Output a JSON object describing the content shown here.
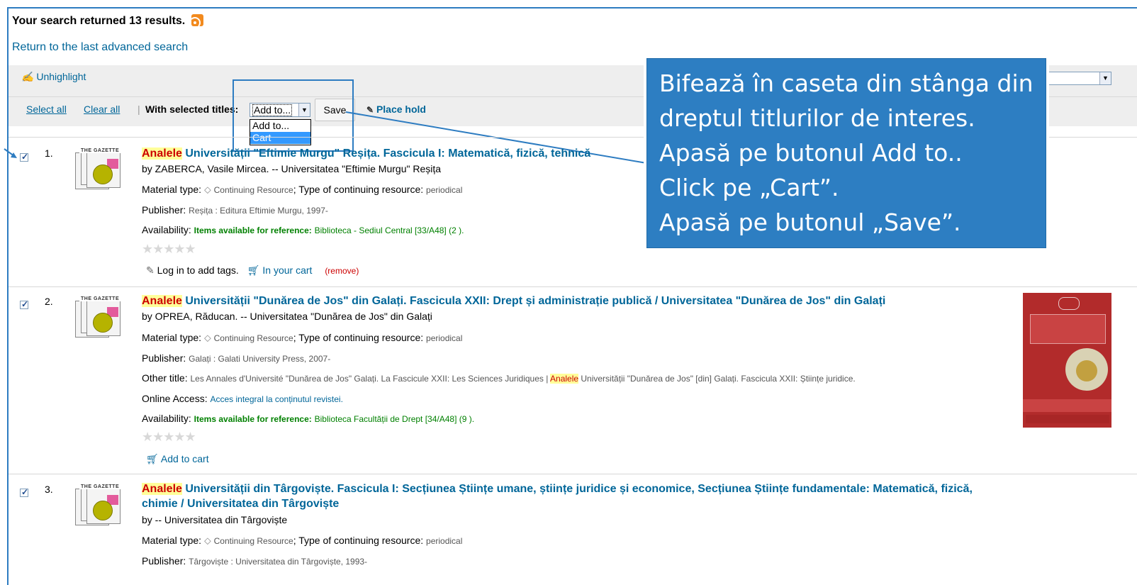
{
  "header": {
    "results_text": "Your search returned 13 results.",
    "return_link": "Return to the last advanced search"
  },
  "toolbar": {
    "unhighlight": "Unhighlight",
    "select_all": "Select all",
    "clear_all": "Clear all",
    "with_selected": "With selected titles:",
    "add_to_value": "Add to...",
    "dropdown_options": [
      "Add to...",
      "Cart"
    ],
    "save_label": "Save",
    "place_hold": "Place hold"
  },
  "callout": {
    "lines": [
      "Bifează în caseta din stânga din",
      "dreptul titlurilor de interes.",
      "Apasă pe butonul Add to..",
      "Click pe „Cart”.",
      "Apasă pe butonul „Save”."
    ]
  },
  "labels": {
    "material_type": "Material type:",
    "continuing_resource": "Continuing Resource",
    "type_of_cr": "; Type of continuing resource:",
    "periodical": "periodical",
    "publisher": "Publisher:",
    "availability": "Availability:",
    "items_available": "Items available for reference:",
    "other_title": "Other title:",
    "online_access": "Online Access:",
    "gazette": "THE GAZETTE"
  },
  "results": [
    {
      "num": "1.",
      "hl": "Analele",
      "title": " Universității \"Eftimie Murgu\" Reșița. Fascicula I: Matematică, fizică, tehnică",
      "by": "by ZABERCA, Vasile Mircea. -- Universitatea \"Eftimie Murgu\" Reșița",
      "publisher": "Reșița : Editura Eftimie Murgu, 1997-",
      "availability": "Biblioteca - Sediul Central [33/A48] (2 ).",
      "tags": "Log in to add tags.",
      "in_cart": "In your cart",
      "remove": "(remove)"
    },
    {
      "num": "2.",
      "hl": "Analele",
      "title": " Universității \"Dunărea de Jos\" din Galați. Fascicula XXII: Drept și administrație publică / Universitatea \"Dunărea de Jos\" din Galați",
      "by": "by OPREA, Răducan. -- Universitatea \"Dunărea de Jos\" din Galați",
      "publisher": "Galați : Galati University Press, 2007-",
      "other_title_pre": "Les Annales d'Université \"Dunărea de Jos\" Galați. La Fascicule XXII: Les Sciences Juridiques | ",
      "other_title_hl": "Analele",
      "other_title_post": " Universității \"Dunărea de Jos\" [din] Galați. Fascicula XXII: Științe juridice.",
      "online_access": "Acces integral la conținutul revistei.",
      "availability": "Biblioteca Facultății de Drept [34/A48] (9 ).",
      "add_to_cart": "Add to cart"
    },
    {
      "num": "3.",
      "hl": "Analele",
      "title": " Universității din Târgoviște. Fascicula I: Secțiunea Științe umane, științe juridice și economice, Secțiunea Științe fundamentale: Matematică, fizică,",
      "title_line2": "chimie / Universitatea din Târgoviște",
      "by": "by -- Universitatea din Târgoviște",
      "publisher": "Târgoviște : Universitatea din Târgoviște, 1993-"
    }
  ]
}
